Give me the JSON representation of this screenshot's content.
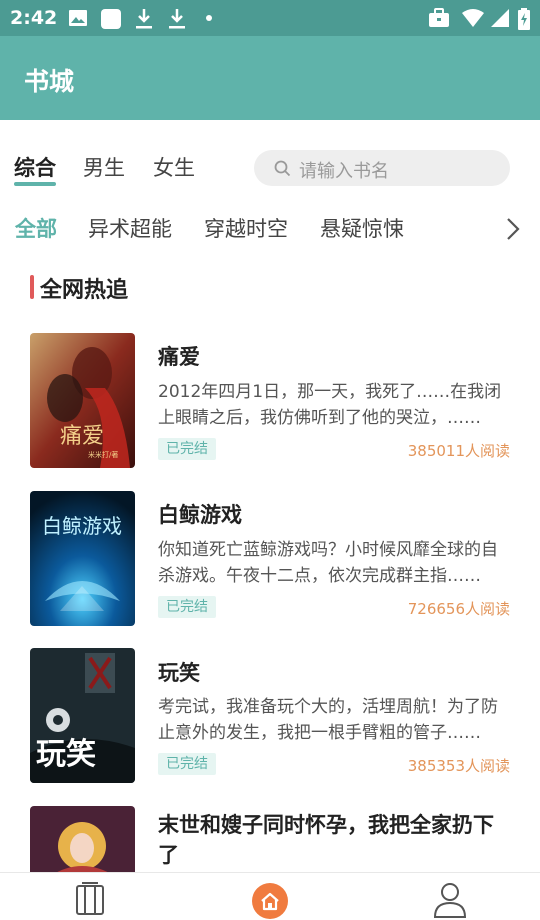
{
  "status_bar": {
    "time": "2:42",
    "left_icons": [
      "image-icon",
      "app-icon",
      "download-icon",
      "download-icon",
      "dot-icon"
    ],
    "right_icons": [
      "briefcase-icon",
      "wifi-icon",
      "signal-icon",
      "battery-charging-icon"
    ]
  },
  "app_bar": {
    "title": "书城"
  },
  "tabs": [
    {
      "label": "综合",
      "active": true
    },
    {
      "label": "男生",
      "active": false
    },
    {
      "label": "女生",
      "active": false
    }
  ],
  "search": {
    "placeholder": "请输入书名"
  },
  "categories": [
    {
      "label": "全部",
      "active": true
    },
    {
      "label": "异术超能",
      "active": false
    },
    {
      "label": "穿越时空",
      "active": false
    },
    {
      "label": "悬疑惊悚",
      "active": false
    }
  ],
  "section": {
    "title": "全网热追"
  },
  "books": [
    {
      "title": "痛爱",
      "desc": "2012年四月1日，那一天，我死了……在我闭上眼睛之后，我仿佛听到了他的哭泣，……",
      "status": "已完结",
      "readers": "385011人阅读",
      "cover_title": "痛爱",
      "cover_author": "米米打/著"
    },
    {
      "title": "白鲸游戏",
      "desc": "你知道死亡蓝鲸游戏吗？小时候风靡全球的自杀游戏。午夜十二点，依次完成群主指……",
      "status": "已完结",
      "readers": "726656人阅读",
      "cover_title": "白鲸游戏"
    },
    {
      "title": "玩笑",
      "desc": "考完试，我准备玩个大的，活埋周航！为了防止意外的发生，我把一根手臂粗的管子……",
      "status": "已完结",
      "readers": "385353人阅读",
      "cover_title": "玩笑"
    },
    {
      "title": "末世和嫂子同时怀孕，我把全家扔下了",
      "desc": "",
      "status": "",
      "readers": ""
    }
  ],
  "bottom_nav": [
    {
      "icon": "bookshelf-icon",
      "active": false
    },
    {
      "icon": "home-icon",
      "active": true
    },
    {
      "icon": "profile-icon",
      "active": false
    }
  ],
  "colors": {
    "status_bar": "#4c9b93",
    "app_bar": "#5fb3aa",
    "accent": "#5fb3aa",
    "section_marker": "#e05a5a",
    "readers": "#e3955a",
    "home_active": "#f07b3f"
  }
}
